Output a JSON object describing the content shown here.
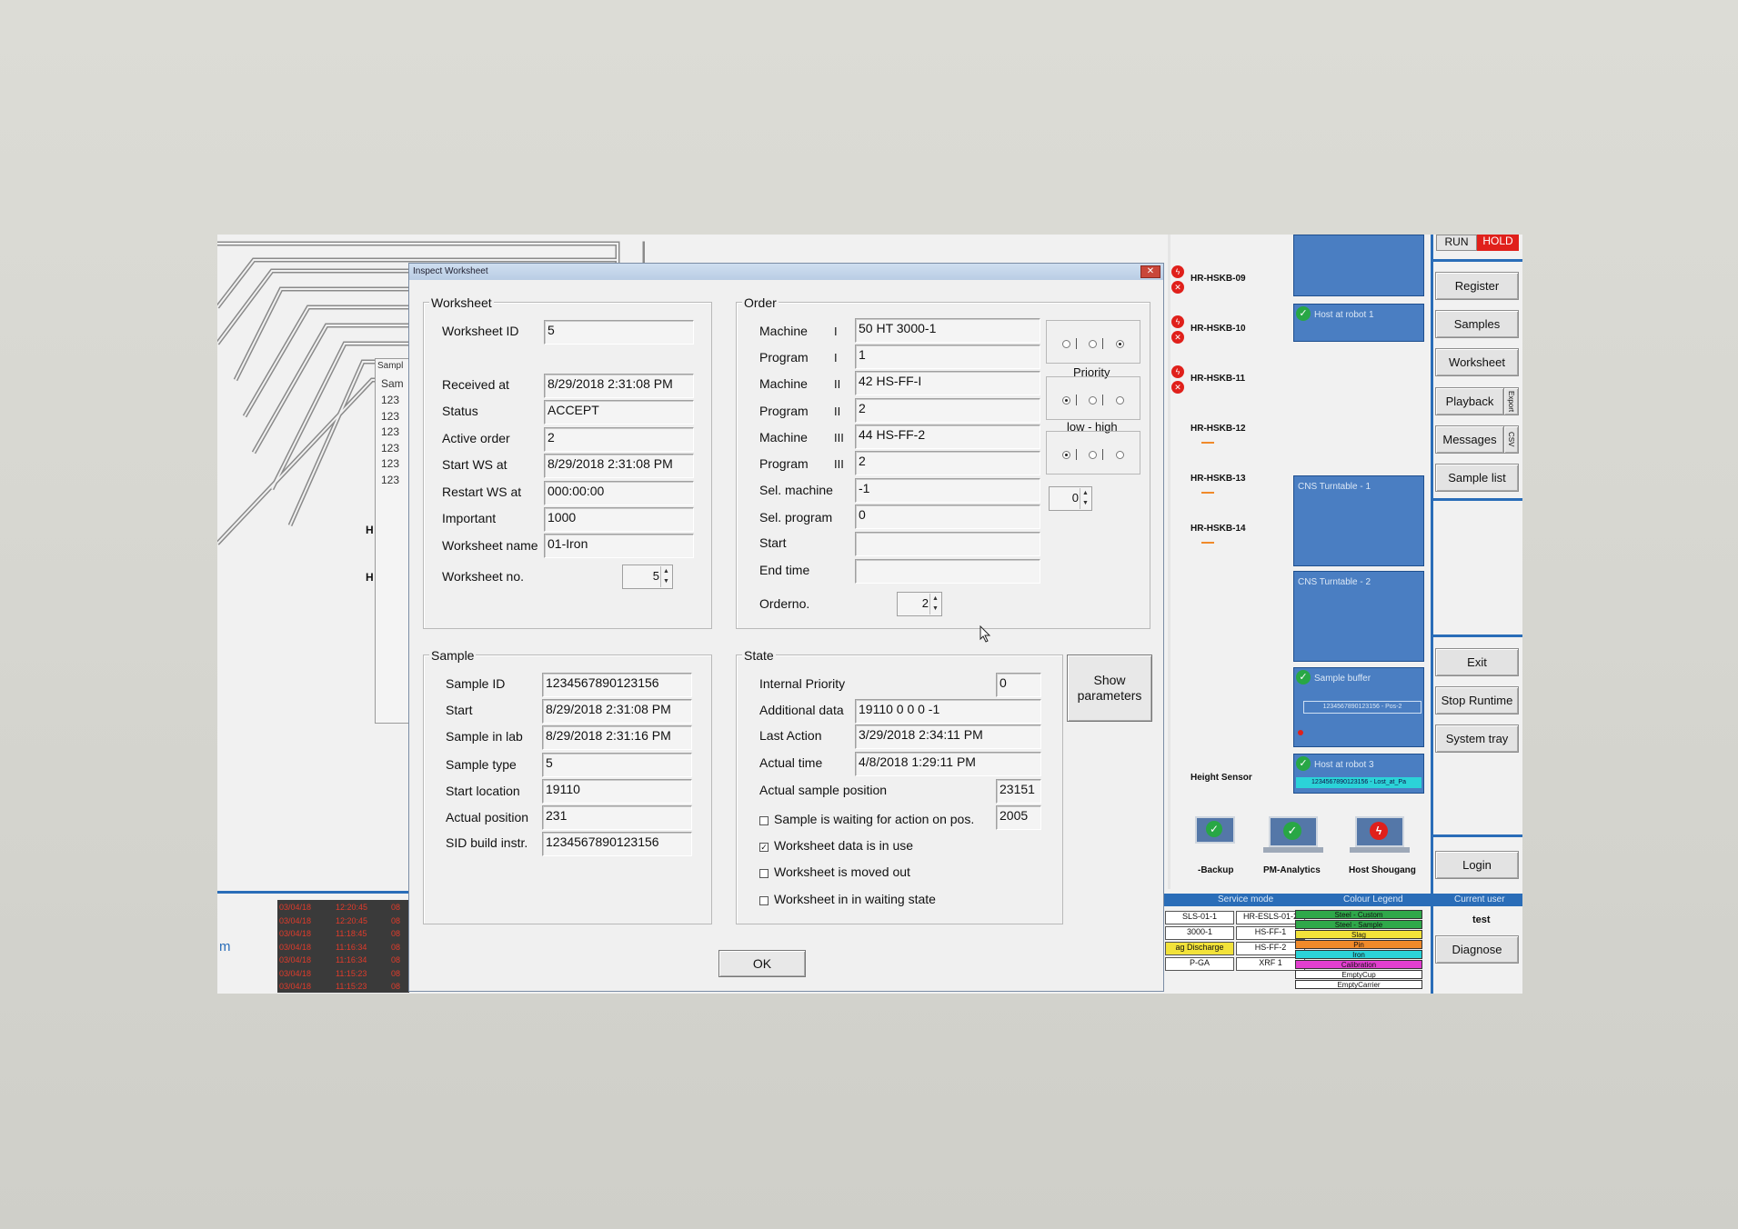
{
  "dialog": {
    "title": "Inspect Worksheet",
    "close_label": "✕",
    "ok_label": "OK",
    "show_params_label": "Show parameters"
  },
  "worksheet_group": {
    "title": "Worksheet",
    "fields": [
      {
        "label": "Worksheet ID",
        "value": "5"
      },
      {
        "label": "Received at",
        "value": "8/29/2018 2:31:08 PM"
      },
      {
        "label": "Status",
        "value": "ACCEPT"
      },
      {
        "label": "Active order",
        "value": "2"
      },
      {
        "label": "Start WS at",
        "value": "8/29/2018 2:31:08 PM"
      },
      {
        "label": "Restart WS at",
        "value": "000:00:00"
      },
      {
        "label": "Important",
        "value": "1000"
      },
      {
        "label": "Worksheet name",
        "value": "01-Iron"
      }
    ],
    "no_label": "Worksheet no.",
    "no_value": "5"
  },
  "order_group": {
    "title": "Order",
    "rows": [
      {
        "label": "Machine",
        "roman": "I",
        "value": "50 HT 3000-1"
      },
      {
        "label": "Program",
        "roman": "I",
        "value": "1"
      },
      {
        "label": "Machine",
        "roman": "II",
        "value": "42 HS-FF-I"
      },
      {
        "label": "Program",
        "roman": "II",
        "value": "2"
      },
      {
        "label": "Machine",
        "roman": "III",
        "value": "44 HS-FF-2"
      },
      {
        "label": "Program",
        "roman": "III",
        "value": "2"
      },
      {
        "label": "Sel. machine",
        "roman": "",
        "value": "-1"
      },
      {
        "label": "Sel. program",
        "roman": "",
        "value": "0"
      },
      {
        "label": "Start",
        "roman": "",
        "value": ""
      },
      {
        "label": "End time",
        "roman": "",
        "value": ""
      }
    ],
    "orderno_label": "Orderno.",
    "orderno_value": "2",
    "priority_label": "Priority",
    "low_high_label": "low - high",
    "priority_spin_value": "0"
  },
  "sample_group": {
    "title": "Sample",
    "fields": [
      {
        "label": "Sample ID",
        "value": "1234567890123156"
      },
      {
        "label": "Start",
        "value": "8/29/2018 2:31:08 PM"
      },
      {
        "label": "Sample in lab",
        "value": "8/29/2018 2:31:16 PM"
      },
      {
        "label": "Sample type",
        "value": "5"
      },
      {
        "label": "Start location",
        "value": "19110"
      },
      {
        "label": "Actual position",
        "value": "231"
      },
      {
        "label": "SID build instr.",
        "value": "1234567890123156"
      }
    ]
  },
  "state_group": {
    "title": "State",
    "fields": [
      {
        "label": "Internal Priority",
        "value": "0"
      },
      {
        "label": "Additional data",
        "value": "19110 0 0 0 -1"
      },
      {
        "label": "Last Action",
        "value": "3/29/2018 2:34:11 PM"
      },
      {
        "label": "Actual time",
        "value": "4/8/2018 1:29:11 PM"
      }
    ],
    "actual_sample_position_label": "Actual sample position",
    "actual_sample_position_value": "23151",
    "checks": [
      {
        "label": "Sample is waiting for action on pos.",
        "checked": false,
        "value": "2005"
      },
      {
        "label": "Worksheet data is in use",
        "checked": true
      },
      {
        "label": "Worksheet is moved out",
        "checked": false
      },
      {
        "label": "Worksheet in in waiting state",
        "checked": false
      }
    ]
  },
  "right_panel": {
    "run_label": "RUN",
    "hold_label": "HOLD",
    "buttons": [
      "Register",
      "Samples",
      "Worksheet",
      "Playback",
      "Messages",
      "Sample list",
      "Exit",
      "Stop Runtime",
      "System tray",
      "Login",
      "Diagnose"
    ],
    "export_label": "Export",
    "csv_label": "CSV",
    "boxes": [
      "Host at robot 1",
      "CNS Turntable - 1",
      "CNS Turntable - 2",
      "Sample buffer",
      "Host at robot 3"
    ],
    "buffer_id": "1234567890123156 - Pos-2",
    "robot3_id": "1234567890123156 - Lost_at_Pa",
    "stations": [
      "HR-HSKB-09",
      "HR-HSKB-10",
      "HR-HSKB-11",
      "HR-HSKB-12",
      "HR-HSKB-13",
      "HR-HSKB-14"
    ],
    "height_sensor": "Height Sensor",
    "computers": [
      "-Backup",
      "PM-Analytics",
      "Host Shougang"
    ],
    "service_mode": "Service mode",
    "colour_legend": "Colour Legend",
    "current_user": "Current user",
    "user": "test",
    "legend_items": [
      {
        "label": "Steel - Custom",
        "color": "#2fa84a"
      },
      {
        "label": "Steel - Sample",
        "color": "#2fa84a"
      },
      {
        "label": "Slag",
        "color": "#f2e23a"
      },
      {
        "label": "Pin",
        "color": "#f08a2a"
      },
      {
        "label": "Iron",
        "color": "#2bd3d8"
      },
      {
        "label": "Calibration",
        "color": "#e23fcf"
      },
      {
        "label": "EmptyCup",
        "color": "#ffffff"
      },
      {
        "label": "EmptyCarrier",
        "color": "#ffffff"
      }
    ],
    "service_rows": [
      [
        "SLS-01-1",
        "HR-ESLS-01-2"
      ],
      [
        "3000-1",
        "HS-FF-1"
      ],
      [
        "ag Discharge",
        "HS-FF-2"
      ],
      [
        "P-GA",
        "XRF 1"
      ]
    ]
  },
  "background": {
    "sample_window_title": "Sampl",
    "sample_col": "Sam",
    "sample_rows": [
      "123",
      "123",
      "123",
      "123",
      "123",
      "123"
    ],
    "h_labels": [
      "H",
      "H"
    ],
    "m_label": "m",
    "red_rows": [
      [
        "03/04/18",
        "12:20:45",
        "08"
      ],
      [
        "03/04/18",
        "12:20:45",
        "08"
      ],
      [
        "03/04/18",
        "11:18:45",
        "08"
      ],
      [
        "03/04/18",
        "11:16:34",
        "08"
      ],
      [
        "03/04/18",
        "11:16:34",
        "08"
      ],
      [
        "03/04/18",
        "11:15:23",
        "08"
      ],
      [
        "03/04/18",
        "11:15:23",
        "08"
      ]
    ]
  },
  "colors": {
    "accent_blue": "#4a7ec2",
    "hold_red": "#e0201b",
    "status_blue": "#2a6db8"
  }
}
